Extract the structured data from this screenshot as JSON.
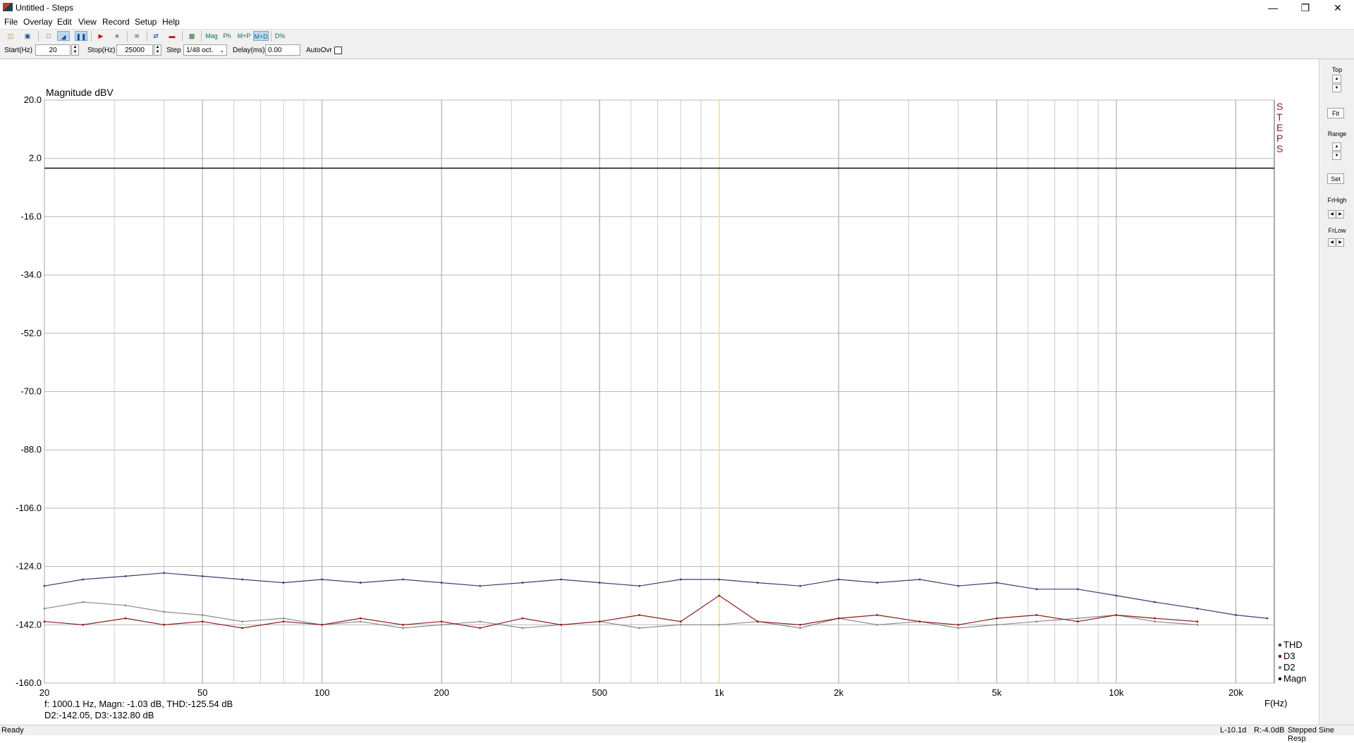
{
  "window": {
    "title": "Untitled - Steps"
  },
  "menu": [
    "File",
    "Overlay",
    "Edit",
    "View",
    "Record",
    "Setup",
    "Help"
  ],
  "toolbar": {
    "mag": "Mag",
    "ph": "Ph",
    "mp": "M+P",
    "md": "M+D",
    "pct": "D%"
  },
  "params": {
    "start_label": "Start(Hz)",
    "start_value": "20",
    "stop_label": "Stop(Hz)",
    "stop_value": "25000",
    "step_label": "Step",
    "step_value": "1/48 oct.",
    "delay_label": "Delay(ms)",
    "delay_value": "0.00",
    "autoovr_label": "AutoOvr"
  },
  "right_panel": {
    "top": "Top",
    "fit": "Fit",
    "range": "Range",
    "set": "Set",
    "frhigh": "FrHigh",
    "frlow": "FrLow"
  },
  "readout": {
    "line1": "f: 1000.1 Hz, Magn: -1.03 dB, THD:-125.54  dB",
    "line2": "D2:-142.05, D3:-132.80 dB"
  },
  "status": {
    "left": "Ready",
    "levels": "L-10.1d",
    "levels2": "R:-4.0dB",
    "mode": "Stepped Sine Resp"
  },
  "colors": {
    "magn": "#1a1a1a",
    "thd": "#3c3c6e",
    "d2": "#8a8a8a",
    "d3": "#8b1a1a",
    "cursor": "#e8e08a",
    "steps_text": "#8b1a1a"
  },
  "chart_data": {
    "type": "line",
    "title": "Magnitude dBV",
    "xlabel": "F(Hz)",
    "x_scale": "log",
    "xlim": [
      20,
      25000
    ],
    "ylim": [
      -160,
      20
    ],
    "yticks": [
      "20.0",
      "2.0",
      "-16.0",
      "-34.0",
      "-52.0",
      "-70.0",
      "-88.0",
      "-106.0",
      "-124.0",
      "-142.0",
      "-160.0"
    ],
    "xticks": [
      {
        "v": 20,
        "label": "20"
      },
      {
        "v": 50,
        "label": "50"
      },
      {
        "v": 100,
        "label": "100"
      },
      {
        "v": 200,
        "label": "200"
      },
      {
        "v": 500,
        "label": "500"
      },
      {
        "v": 1000,
        "label": "1k"
      },
      {
        "v": 2000,
        "label": "2k"
      },
      {
        "v": 5000,
        "label": "5k"
      },
      {
        "v": 10000,
        "label": "10k"
      },
      {
        "v": 20000,
        "label": "20k"
      }
    ],
    "cursor_hz": 1000,
    "brand": "STEPS",
    "legend": [
      "THD",
      "D3",
      "D2",
      "Magn"
    ],
    "series": [
      {
        "name": "Magn",
        "x": [
          20,
          25000
        ],
        "y": [
          -1.03,
          -1.03
        ]
      },
      {
        "name": "THD",
        "x": [
          20,
          25,
          32,
          40,
          50,
          63,
          80,
          100,
          125,
          160,
          200,
          250,
          320,
          400,
          500,
          630,
          800,
          1000,
          1250,
          1600,
          2000,
          2500,
          3200,
          4000,
          5000,
          6300,
          8000,
          10000,
          12500,
          16000,
          20000,
          24000
        ],
        "y": [
          -130,
          -128,
          -127,
          -126,
          -127,
          -128,
          -129,
          -128,
          -129,
          -128,
          -129,
          -130,
          -129,
          -128,
          -129,
          -130,
          -128,
          -128,
          -129,
          -130,
          -128,
          -129,
          -128,
          -130,
          -129,
          -131,
          -131,
          -133,
          -135,
          -137,
          -139,
          -140
        ]
      },
      {
        "name": "D2",
        "x": [
          20,
          25,
          32,
          40,
          50,
          63,
          80,
          100,
          125,
          160,
          200,
          250,
          320,
          400,
          500,
          630,
          800,
          1000,
          1250,
          1600,
          2000,
          2500,
          3200,
          4000,
          5000,
          6300,
          8000,
          10000,
          12500,
          16000
        ],
        "y": [
          -137,
          -135,
          -136,
          -138,
          -139,
          -141,
          -140,
          -142,
          -141,
          -143,
          -142,
          -141,
          -143,
          -142,
          -141,
          -143,
          -142,
          -142,
          -141,
          -143,
          -140,
          -142,
          -141,
          -143,
          -142,
          -141,
          -140,
          -139,
          -141,
          -142
        ]
      },
      {
        "name": "D3",
        "x": [
          20,
          25,
          32,
          40,
          50,
          63,
          80,
          100,
          125,
          160,
          200,
          250,
          320,
          400,
          500,
          630,
          800,
          1000,
          1250,
          1600,
          2000,
          2500,
          3200,
          4000,
          5000,
          6300,
          8000,
          10000,
          12500,
          16000
        ],
        "y": [
          -141,
          -142,
          -140,
          -142,
          -141,
          -143,
          -141,
          -142,
          -140,
          -142,
          -141,
          -143,
          -140,
          -142,
          -141,
          -139,
          -141,
          -133,
          -141,
          -142,
          -140,
          -139,
          -141,
          -142,
          -140,
          -139,
          -141,
          -139,
          -140,
          -141
        ]
      }
    ]
  }
}
